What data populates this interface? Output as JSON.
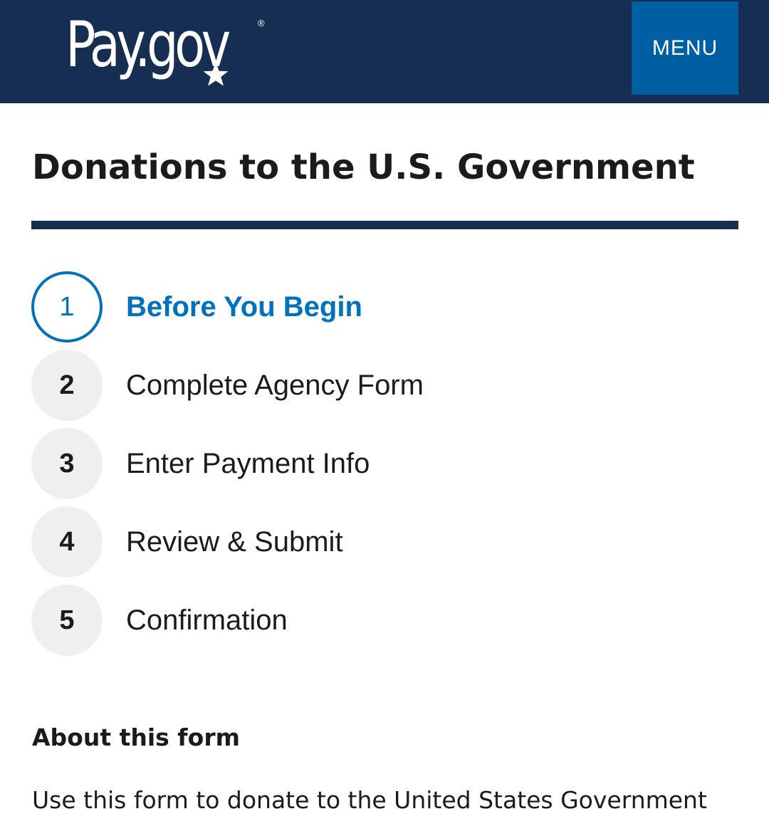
{
  "header": {
    "logo_text": "Pay.gov",
    "logo_registered": "®",
    "menu_label": "MENU",
    "background_color": "#162e51",
    "menu_color": "#005ea2"
  },
  "page": {
    "title": "Donations to the U.S. Government"
  },
  "steps": [
    {
      "number": "1",
      "label": "Before You Begin",
      "current": true
    },
    {
      "number": "2",
      "label": "Complete Agency Form",
      "current": false
    },
    {
      "number": "3",
      "label": "Enter Payment Info",
      "current": false
    },
    {
      "number": "4",
      "label": "Review & Submit",
      "current": false
    },
    {
      "number": "5",
      "label": "Confirmation",
      "current": false
    }
  ],
  "about": {
    "heading": "About this form",
    "text": "Use this form to donate to the United States Government"
  },
  "colors": {
    "accent": "#0071bc",
    "step_inactive_bg": "#efefef",
    "text": "#1b1b1b"
  }
}
